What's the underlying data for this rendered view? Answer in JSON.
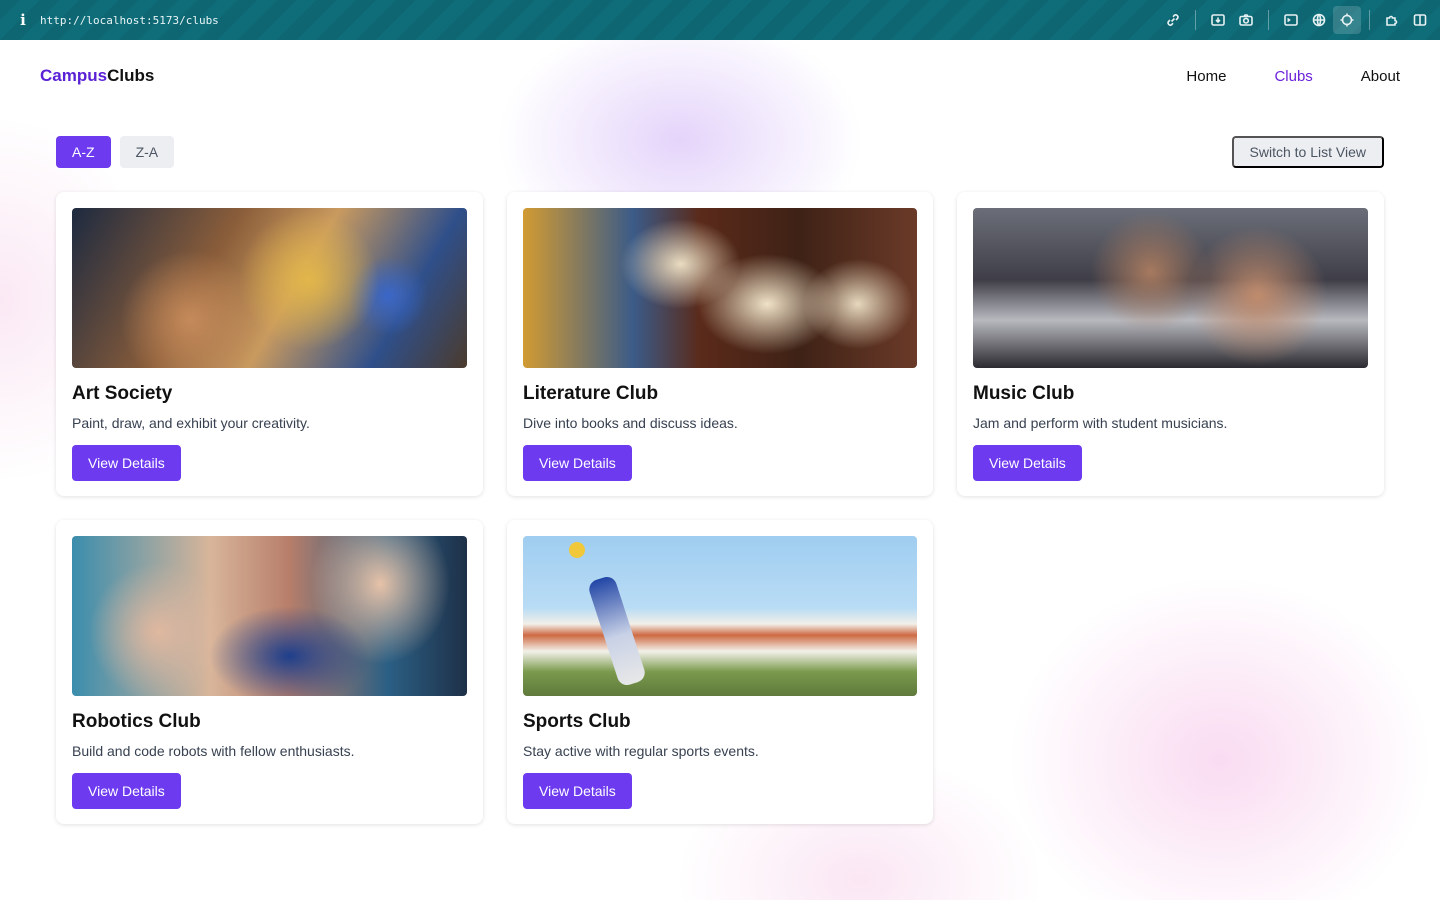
{
  "browser": {
    "url": "http://localhost:5173/clubs",
    "tool_icons": [
      "link-icon",
      "download-icon",
      "camera-icon",
      "terminal-icon",
      "globe-icon",
      "crosshair-icon",
      "extension-icon",
      "sidebar-icon"
    ]
  },
  "header": {
    "logo_part1": "Campus",
    "logo_part2": "Clubs",
    "nav": [
      "Home",
      "Clubs",
      "About"
    ],
    "active_nav": "Clubs"
  },
  "controls": {
    "sort_az": "A-Z",
    "sort_za": "Z-A",
    "active_sort": "A-Z",
    "view_toggle": "Switch to List View"
  },
  "clubs": [
    {
      "name": "Art Society",
      "description": "Paint, draw, and exhibit your creativity.",
      "button": "View Details"
    },
    {
      "name": "Literature Club",
      "description": "Dive into books and discuss ideas.",
      "button": "View Details"
    },
    {
      "name": "Music Club",
      "description": "Jam and perform with student musicians.",
      "button": "View Details"
    },
    {
      "name": "Robotics Club",
      "description": "Build and code robots with fellow enthusiasts.",
      "button": "View Details"
    },
    {
      "name": "Sports Club",
      "description": "Stay active with regular sports events.",
      "button": "View Details"
    }
  ],
  "colors": {
    "accent": "#6d3af0",
    "logo_accent": "#5b21d6",
    "browser_bar": "#0d6672"
  }
}
